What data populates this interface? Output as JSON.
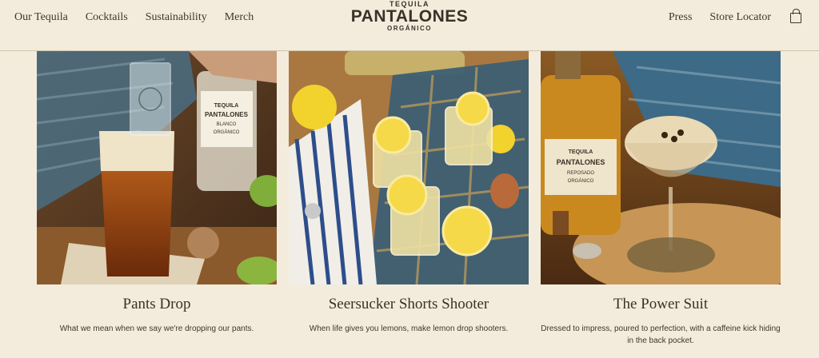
{
  "nav": {
    "left": [
      "Our Tequila",
      "Cocktails",
      "Sustainability",
      "Merch"
    ],
    "right": [
      "Press",
      "Store Locator"
    ],
    "cart_icon": "shopping-bag-icon"
  },
  "logo": {
    "top": "TEQUILA",
    "main": "PANTALONES",
    "bottom": "ORGÁNICO"
  },
  "cards": [
    {
      "title": "Pants Drop",
      "description": "What we mean when we say we're dropping our pants.",
      "label_text": "TEQUILA PANTALONES BLANCO ORGÁNICO"
    },
    {
      "title": "Seersucker Shorts Shooter",
      "description": "When life gives you lemons, make lemon drop shooters."
    },
    {
      "title": "The Power Suit",
      "description": "Dressed to impress, poured to perfection, with a caffeine kick hiding in the back pocket.",
      "label_text": "TEQUILA PANTALONES REPOSADO ORGÁNICO"
    }
  ],
  "colors": {
    "background": "#f3ecdc",
    "text": "#3a3128"
  }
}
